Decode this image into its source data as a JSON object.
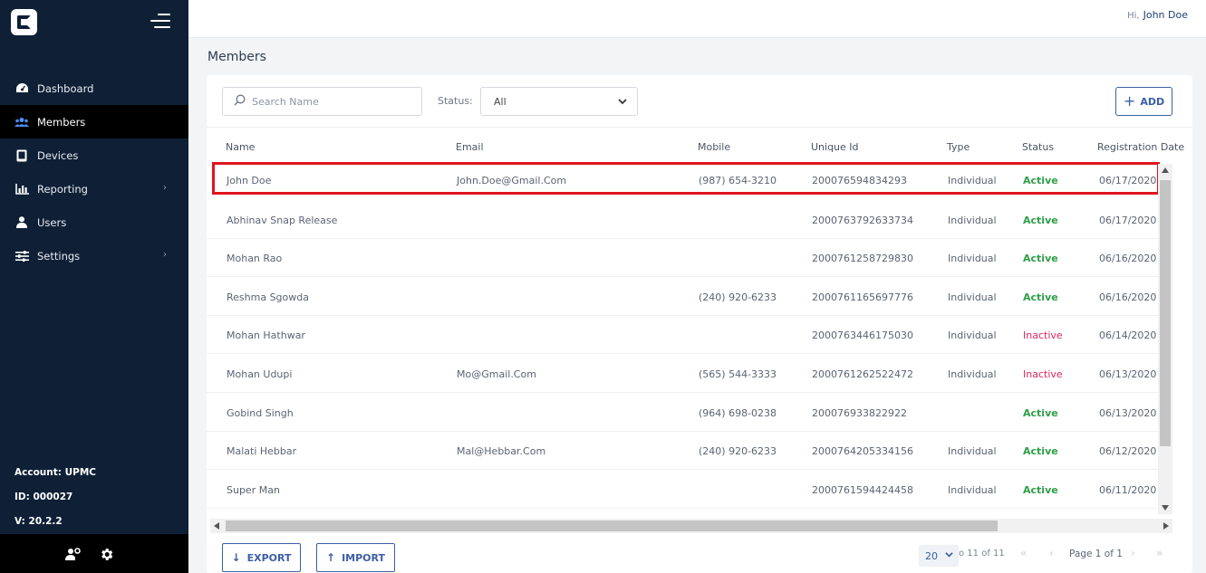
{
  "header": {
    "greeting": "Hi,",
    "user_name": "John Doe"
  },
  "sidebar": {
    "items": [
      {
        "label": "Dashboard",
        "icon": "dashboard-icon"
      },
      {
        "label": "Members",
        "icon": "members-icon",
        "active": true
      },
      {
        "label": "Devices",
        "icon": "devices-icon"
      },
      {
        "label": "Reporting",
        "icon": "reporting-icon",
        "has_submenu": true
      },
      {
        "label": "Users",
        "icon": "users-icon"
      },
      {
        "label": "Settings",
        "icon": "settings-icon",
        "has_submenu": true
      }
    ],
    "account": "Account: UPMC",
    "id": "ID: 000027",
    "version": "V: 20.2.2"
  },
  "page": {
    "title": "Members"
  },
  "filters": {
    "search_placeholder": "Search Name",
    "status_label": "Status:",
    "status_value": "All",
    "add_label": "ADD"
  },
  "table": {
    "columns": [
      "Name",
      "Email",
      "Mobile",
      "Unique Id",
      "Type",
      "Status",
      "Registration Date"
    ],
    "rows": [
      {
        "name": "John Doe",
        "email": "John.Doe@Gmail.Com",
        "mobile": "(987) 654-3210",
        "uid": "200076594834293",
        "type": "Individual",
        "status": "Active",
        "date": "06/17/2020"
      },
      {
        "name": "Abhinav Snap Release",
        "email": "",
        "mobile": "",
        "uid": "2000763792633734",
        "type": "Individual",
        "status": "Active",
        "date": "06/17/2020"
      },
      {
        "name": "Mohan Rao",
        "email": "",
        "mobile": "",
        "uid": "2000761258729830",
        "type": "Individual",
        "status": "Active",
        "date": "06/16/2020"
      },
      {
        "name": "Reshma Sgowda",
        "email": "",
        "mobile": "(240) 920-6233",
        "uid": "2000761165697776",
        "type": "Individual",
        "status": "Active",
        "date": "06/16/2020"
      },
      {
        "name": "Mohan Hathwar",
        "email": "",
        "mobile": "",
        "uid": "2000763446175030",
        "type": "Individual",
        "status": "Inactive",
        "date": "06/14/2020"
      },
      {
        "name": "Mohan Udupi",
        "email": "Mo@Gmail.Com",
        "mobile": "(565) 544-3333",
        "uid": "2000761262522472",
        "type": "Individual",
        "status": "Inactive",
        "date": "06/13/2020"
      },
      {
        "name": "Gobind Singh",
        "email": "",
        "mobile": "(964) 698-0238",
        "uid": "200076933822922",
        "type": "",
        "status": "Active",
        "date": "06/13/2020"
      },
      {
        "name": "Malati Hebbar",
        "email": "Mal@Hebbar.Com",
        "mobile": "(240) 920-6233",
        "uid": "2000764205334156",
        "type": "Individual",
        "status": "Active",
        "date": "06/12/2020"
      },
      {
        "name": "Super Man",
        "email": "",
        "mobile": "",
        "uid": "2000761594424458",
        "type": "Individual",
        "status": "Active",
        "date": "06/11/2020"
      }
    ]
  },
  "footer": {
    "export_label": "EXPORT",
    "import_label": "IMPORT",
    "page_size": "20",
    "range_text": "o 11 of 11",
    "page_text": "Page 1 of 1"
  },
  "colors": {
    "sidebar_bg": "#0f2036",
    "accent": "#3b5fa6",
    "active": "#2f9e48",
    "inactive": "#e0245e",
    "highlight": "#e0141e"
  }
}
